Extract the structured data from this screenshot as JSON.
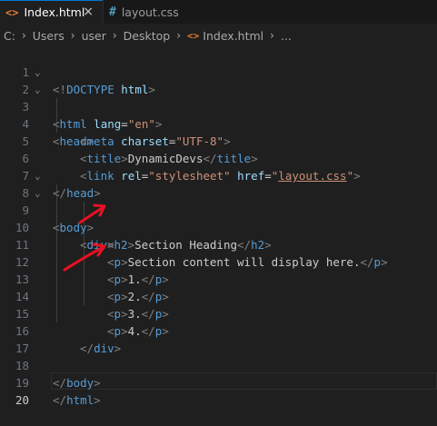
{
  "tabs": [
    {
      "icon": "<>",
      "label": "Index.html",
      "close": "×"
    },
    {
      "icon": "#",
      "label": "layout.css"
    }
  ],
  "breadcrumb": [
    "C:",
    "Users",
    "user",
    "Desktop",
    "Index.html",
    "..."
  ],
  "colors": {
    "editor_bg": "#1f1f1f",
    "tag": "#569cd6",
    "attribute": "#9cdcfe",
    "string": "#ce9178",
    "bracket": "#808080",
    "annotation_arrow": "#e81123"
  },
  "line_numbers": [
    "1",
    "2",
    "3",
    "4",
    "5",
    "6",
    "7",
    "8",
    "9",
    "10",
    "11",
    "12",
    "13",
    "14",
    "15",
    "16",
    "17",
    "18",
    "19",
    "20"
  ],
  "code": {
    "l1": {
      "a": "<!",
      "b": "DOCTYPE",
      "c": " html",
      "d": ">"
    },
    "l2": {
      "a": "<",
      "b": "html",
      "c": " lang",
      "d": "=",
      "e": "\"en\"",
      "f": ">"
    },
    "l3": {
      "a": "<",
      "b": "head",
      "c": ">"
    },
    "l4": {
      "a": "<",
      "b": "meta",
      "c": " charset",
      "d": "=",
      "e": "\"UTF-8\"",
      "f": ">"
    },
    "l5": {
      "a": "<",
      "b": "title",
      "c": ">",
      "d": "DynamicDevs",
      "e": "</",
      "f": "title",
      "g": ">"
    },
    "l6": {
      "a": "<",
      "b": "link",
      "c": " rel",
      "d": "=",
      "e": "\"stylesheet\"",
      "f": " href",
      "g": "=",
      "h": "\"",
      "i": "layout.css",
      "j": "\"",
      "k": ">"
    },
    "l7": {
      "a": "</",
      "b": "head",
      "c": ">"
    },
    "l8": {
      "a": "<",
      "b": "body",
      "c": ">"
    },
    "l9": {
      "a": "<",
      "b": "div",
      "c": ">"
    },
    "l10": {
      "a": "<",
      "b": "h2",
      "c": ">",
      "d": "Section Heading",
      "e": "</",
      "f": "h2",
      "g": ">"
    },
    "l11": {
      "a": "<",
      "b": "p",
      "c": ">",
      "d": "Section content will display here.",
      "e": "</",
      "f": "p",
      "g": ">"
    },
    "l12": {
      "a": "<",
      "b": "p",
      "c": ">",
      "d": "1.",
      "e": "</",
      "f": "p",
      "g": ">"
    },
    "l13": {
      "a": "<",
      "b": "p",
      "c": ">",
      "d": "2.",
      "e": "</",
      "f": "p",
      "g": ">"
    },
    "l14": {
      "a": "<",
      "b": "p",
      "c": ">",
      "d": "3.",
      "e": "</",
      "f": "p",
      "g": ">"
    },
    "l15": {
      "a": "<",
      "b": "p",
      "c": ">",
      "d": "4.",
      "e": "</",
      "f": "p",
      "g": ">"
    },
    "l16": {
      "a": "</",
      "b": "div",
      "c": ">"
    },
    "l18": {
      "a": "</",
      "b": "body",
      "c": ">"
    },
    "l19": {
      "a": "</",
      "b": "html",
      "c": ">"
    }
  }
}
